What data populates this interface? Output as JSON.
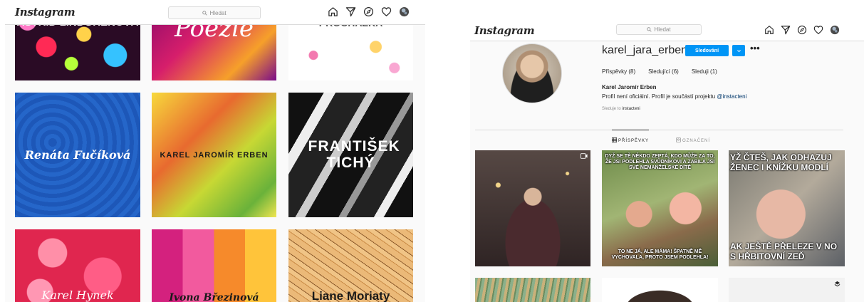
{
  "left": {
    "logo": "Instagram",
    "search_placeholder": "Hledat",
    "tiles": [
      {
        "label": "ASTRID LINDGRENOVÁ"
      },
      {
        "label": "Poezie"
      },
      {
        "label": "PROCHÁZKA"
      },
      {
        "label": "Renáta Fučíková"
      },
      {
        "label": "KAREL JAROMÍR ERBEN"
      },
      {
        "label": "FRANTIŠEK TICHÝ"
      },
      {
        "label": "Karel Hynek"
      },
      {
        "label": "Ivona Březinová"
      },
      {
        "label": "Liane Moriaty"
      }
    ]
  },
  "right": {
    "logo": "Instagram",
    "search_placeholder": "Hledat",
    "profile": {
      "username": "karel_jara_erben",
      "follow_label": "Sledování",
      "more_label": "•••",
      "posts_label": "Příspěvky (8)",
      "followers_label": "Sledující (6)",
      "following_label": "Sleduji (1)",
      "full_name": "Karel Jaromír Erben",
      "bio_text": "Profil není oficiální. Profil je součástí projektu",
      "bio_link": "@instacteni",
      "followed_by_prefix": "Sleduje to",
      "followed_by_name": "instacteni"
    },
    "tabs": {
      "posts": "PŘÍSPĚVKY",
      "tagged": "OZNAČENÍ"
    },
    "posts": {
      "meme1_top": "DYŽ SE TĚ NĚKDO ZEPTÁ, KDO MŮŽE ZA TO, ŽE JSI PODLEHLA SVŮDNÍKOVI A ZABILA JSI SVÉ NEMANŽELSKÉ DÍTĚ",
      "meme1_bottom": "TO NE JÁ, ALE MÁMA! ŠPATNĚ MĚ VYCHOVALA, PROTO JSEM PODLEHLA!",
      "meme2_top": "YŽ ČTEŠ, JAK ODHAZUJ ŽENEC I KNÍŽKU MODLÍ",
      "meme2_bottom": "AK JEŠTĚ PŘELEZE V NO S HŘBITOVNÍ ZEĎ"
    }
  }
}
